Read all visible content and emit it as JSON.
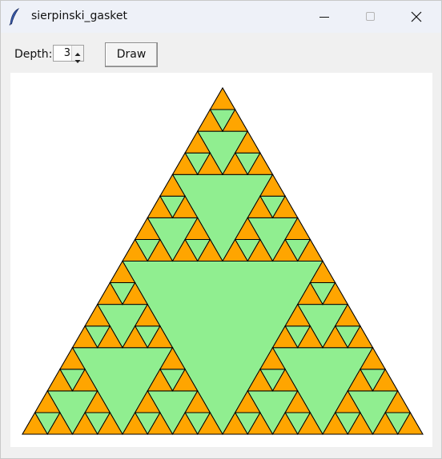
{
  "window": {
    "title": "sierpinski_gasket",
    "icon": "feather-icon",
    "controls": [
      "minimize-icon",
      "maximize-icon",
      "close-icon"
    ]
  },
  "toolbar": {
    "depth_label": "Depth:",
    "depth_value": "3",
    "draw_label": "Draw"
  },
  "canvas": {
    "background": "#ffffff",
    "gasket": {
      "depth": 3,
      "corner_color": "#ffa500",
      "hole_color": "#90ee90",
      "outline_color": "#000000"
    }
  }
}
